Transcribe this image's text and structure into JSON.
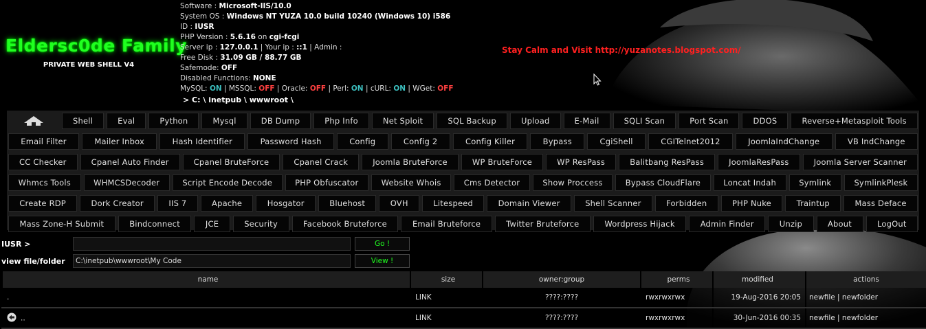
{
  "logo": {
    "title": "Eldersc0de Family",
    "subtitle": "PRIVATE WEB SHELL V4"
  },
  "info": {
    "software_label": "Software :",
    "software": "Microsoft-IIS/10.0",
    "os_label": "System OS :",
    "os": "Windows NT YUZA 10.0 build 10240 (Windows 10) i586",
    "id_label": "ID :",
    "id": "IUSR",
    "php_label": "PHP Version :",
    "php": "5.6.16",
    "php_suffix": "on",
    "php_sapi": "cgi-fcgi",
    "server_ip_label": "Server ip :",
    "server_ip": "127.0.0.1",
    "your_ip_label": "| Your ip :",
    "your_ip": "::1",
    "admin_label": "| Admin :",
    "disk_label": "Free Disk :",
    "disk": "31.09 GB / 88.77 GB",
    "safemode_label": "Safemode:",
    "safemode": "OFF",
    "disabled_label": "Disabled Functions:",
    "disabled": "NONE",
    "mysql_label": "MySQL:",
    "mysql": "ON",
    "mssql_label": "| MSSQL:",
    "mssql": "OFF",
    "oracle_label": "| Oracle:",
    "oracle": "OFF",
    "perl_label": "| Perl:",
    "perl": "ON",
    "curl_label": "| cURL:",
    "curl": "ON",
    "wget_label": "| WGet:",
    "wget": "OFF",
    "path": "> C: \\ inetpub \\ wwwroot \\"
  },
  "slogan": "Stay Calm and Visit http://yuzanotes.blogspot.com/",
  "menu": {
    "row1": [
      "Shell",
      "Eval",
      "Python",
      "Mysql",
      "DB Dump",
      "Php Info",
      "Net Sploit",
      "SQL Backup",
      "Upload",
      "E-Mail",
      "SQLI Scan",
      "Port Scan",
      "DDOS",
      "Reverse+Metasploit Tools"
    ],
    "row2": [
      "Email Filter",
      "Mailer Inbox",
      "Hash Identifier",
      "Password Hash",
      "Config",
      "Config 2",
      "Config Killer",
      "Bypass",
      "CgiShell",
      "CGITelnet2012",
      "JoomlaIndChange",
      "VB IndChange"
    ],
    "row3": [
      "CC Checker",
      "Cpanel Auto Finder",
      "Cpanel BruteForce",
      "Cpanel Crack",
      "Joomla BruteForce",
      "WP BruteForce",
      "WP ResPass",
      "Balitbang ResPass",
      "JoomlaResPass",
      "Joomla Server Scanner"
    ],
    "row4": [
      "Whmcs Tools",
      "WHMCSDecoder",
      "Script Encode Decode",
      "PHP Obfuscator",
      "Website Whois",
      "Cms Detector",
      "Show Proccess",
      "Bypass CloudFlare",
      "Loncat Indah",
      "Symlink",
      "SymlinkPlesk"
    ],
    "row5": [
      "Create RDP",
      "Dork Creator",
      "IIS 7",
      "Apache",
      "Hosgator",
      "Bluehost",
      "OVH",
      "Litespeed",
      "Domain Viewer",
      "Shell Scanner",
      "Forbidden",
      "PHP Nuke",
      "Traintup",
      "Mass Deface"
    ],
    "row6": [
      "Mass Zone-H Submit",
      "Bindconnect",
      "JCE",
      "Security",
      "Facebook Bruteforce",
      "Email Bruteforce",
      "Twitter Bruteforce",
      "Wordpress Hijack",
      "Admin Finder",
      "Unzip",
      "About",
      "LogOut"
    ]
  },
  "cmd": {
    "label": "IUSR >",
    "value": "",
    "button": "Go !"
  },
  "view": {
    "label": "view file/folder",
    "value": "C:\\inetpub\\wwwroot\\My Code",
    "button": "View !"
  },
  "table": {
    "headers": [
      "name",
      "size",
      "owner:group",
      "perms",
      "modified",
      "actions"
    ],
    "rows": [
      {
        "name": ".",
        "size": "LINK",
        "owner": "????:????",
        "perms": "rwxrwxrwx",
        "modified": "19-Aug-2016 20:05",
        "actions": "newfile | newfolder"
      },
      {
        "name": "..",
        "size": "LINK",
        "owner": "????:????",
        "perms": "rwxrwxrwx",
        "modified": "30-Jun-2016 00:35",
        "actions": "newfile | newfolder"
      }
    ]
  },
  "colors": {
    "logo": "#20ff20",
    "slogan": "#ff2020",
    "on": "#3cc0c0",
    "off": "#ff4040",
    "menu_bg": "#1b1b1b"
  }
}
